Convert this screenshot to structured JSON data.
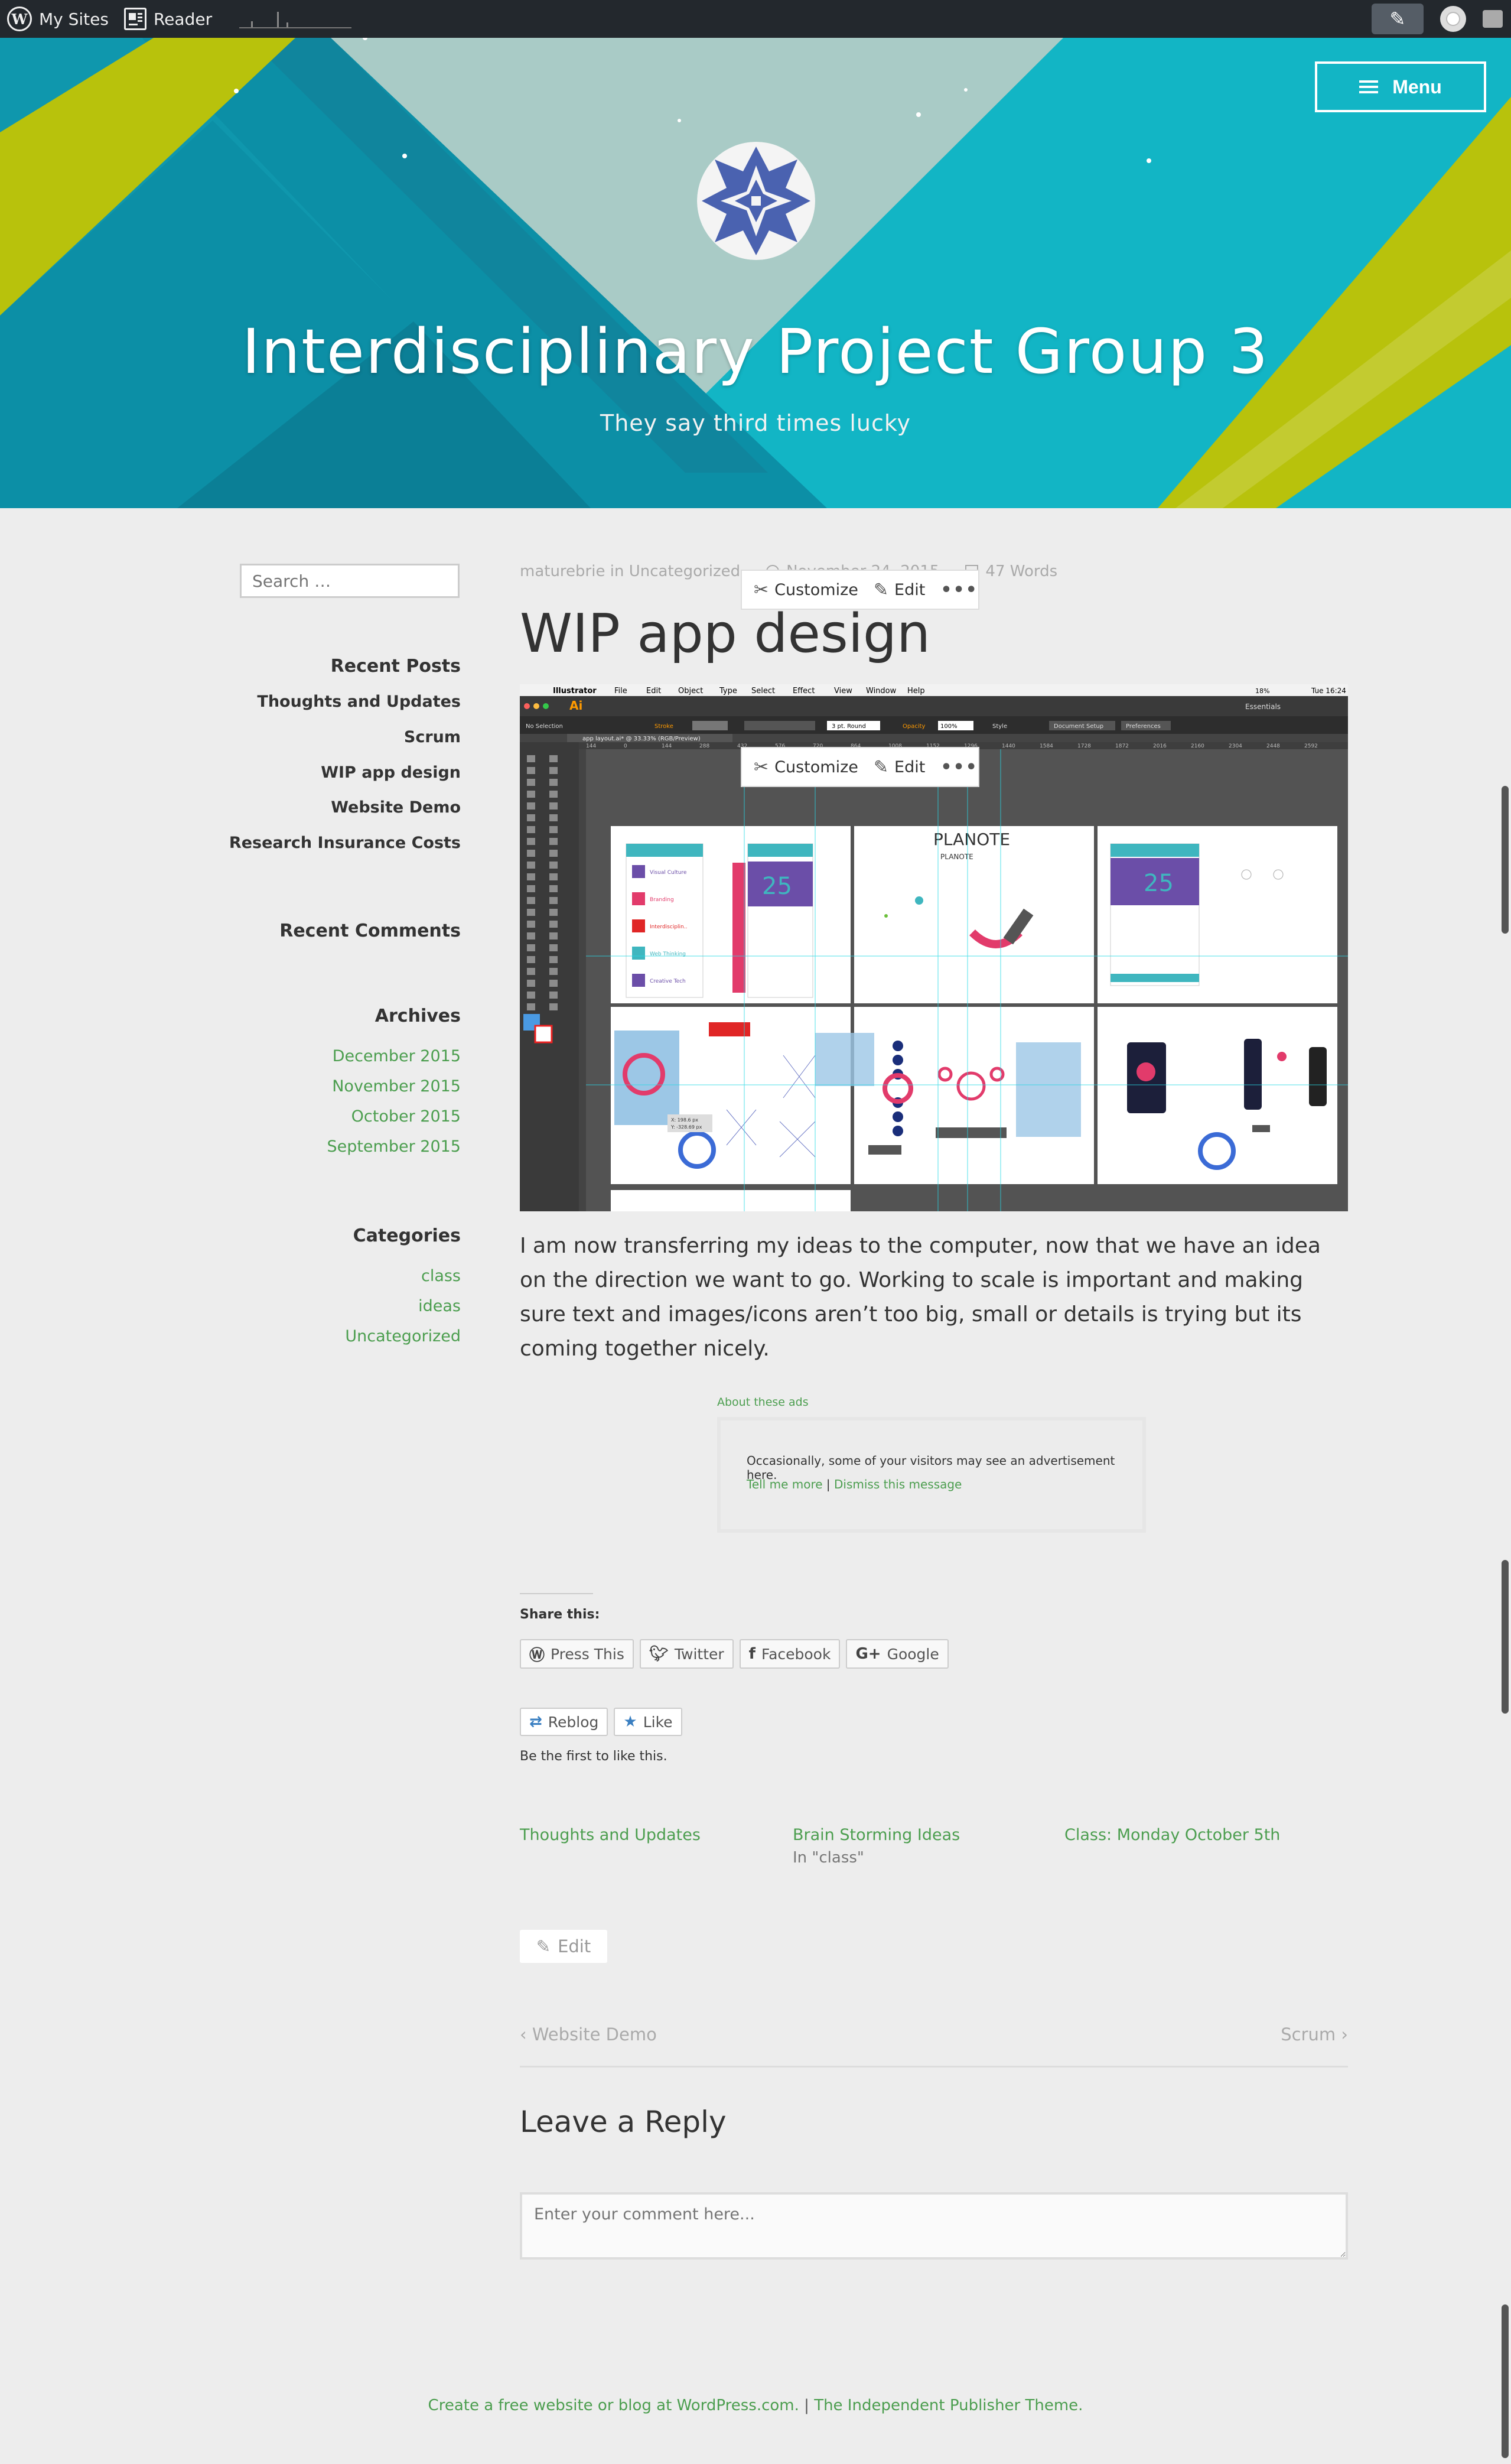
{
  "adminbar": {
    "my_sites": "My Sites",
    "reader": "Reader"
  },
  "header": {
    "menu_label": "Menu",
    "site_title": "Interdisciplinary Project Group 3",
    "tagline": "They say third times lucky"
  },
  "sidebar": {
    "search_placeholder": "Search …",
    "recent_posts_title": "Recent Posts",
    "recent_posts": [
      "Thoughts and Updates",
      "Scrum",
      "WIP app design",
      "Website Demo",
      "Research Insurance Costs"
    ],
    "recent_comments_title": "Recent Comments",
    "archives_title": "Archives",
    "archives": [
      "December 2015",
      "November 2015",
      "October 2015",
      "September 2015"
    ],
    "categories_title": "Categories",
    "categories": [
      "class",
      "ideas",
      "Uncategorized"
    ]
  },
  "post": {
    "author": "maturebrie",
    "in_word": "in",
    "category": "Uncategorized",
    "date": "November 24, 2015",
    "words": "47 Words",
    "title": "WIP app design",
    "body": "I am now transferring my ideas to the computer, now that we have an idea on the direction we want to go. Working to scale is important and making sure text and images/icons aren’t too big, small or details is trying but its coming together nicely."
  },
  "toolbar": {
    "customize": "Customize",
    "edit": "Edit",
    "more": "•••"
  },
  "screenshot": {
    "app_name": "Illustrator",
    "menus": [
      "File",
      "Edit",
      "Object",
      "Type",
      "Select",
      "Effect",
      "View",
      "Window",
      "Help"
    ],
    "clock": "Tue 16:24",
    "battery": "18%",
    "workspace": "Essentials",
    "doc_tab": "app layout.ai* @ 33.33% (RGB/Preview)",
    "no_selection": "No Selection",
    "stroke": "Stroke",
    "stroke_style": "3 pt. Round",
    "opacity_label": "Opacity",
    "opacity": "100%",
    "style_label": "Style",
    "doc_setup": "Document Setup",
    "preferences": "Preferences",
    "ruler_ticks": [
      "144",
      "0",
      "144",
      "288",
      "432",
      "576",
      "720",
      "864",
      "1008",
      "1152",
      "1296",
      "1440",
      "1584",
      "1728",
      "1872",
      "2016",
      "2160",
      "2304",
      "2448",
      "2592"
    ],
    "planote": "PLANOTE",
    "planote_small": "PLANOTE",
    "date_num": "25",
    "list_items": [
      "Visual Culture",
      "Branding",
      "Interdisciplin..",
      "Web Thinking",
      "Creative Tech"
    ],
    "measure_1": "X: 198.6 px",
    "measure_2": "Y: -328.69 px",
    "colors": {
      "purple": "#6b4ea8",
      "pink": "#e23b6b",
      "teal": "#3fb6bf",
      "red": "#e02626"
    }
  },
  "ads": {
    "about": "About these ads",
    "message": "Occasionally, some of your visitors may see an advertisement here.",
    "tell_more": "Tell me more",
    "separator": "|",
    "dismiss": "Dismiss this message"
  },
  "share": {
    "title": "Share this:",
    "buttons": [
      "Press This",
      "Twitter",
      "Facebook",
      "Google"
    ]
  },
  "likes": {
    "reblog": "Reblog",
    "like": "Like",
    "note": "Be the first to like this."
  },
  "related": [
    {
      "title": "Thoughts and Updates",
      "sub": ""
    },
    {
      "title": "Brain Storming Ideas",
      "sub": "In \"class\""
    },
    {
      "title": "Class: Monday October 5th",
      "sub": ""
    }
  ],
  "edit_link": "Edit",
  "postnav": {
    "prev": "Website Demo",
    "next": "Scrum"
  },
  "reply": {
    "title": "Leave a Reply",
    "placeholder": "Enter your comment here..."
  },
  "footer": {
    "create": "Create a free website or blog at WordPress.com.",
    "separator": "|",
    "theme": "The Independent Publisher Theme."
  },
  "palette": {
    "link_green": "#4c9e4f",
    "header_teal": "#0c8fa6",
    "header_cyan": "#12b5c5",
    "header_lime": "#b8c20c",
    "header_mint": "#a9cbc6",
    "adminbar": "#23282d"
  }
}
